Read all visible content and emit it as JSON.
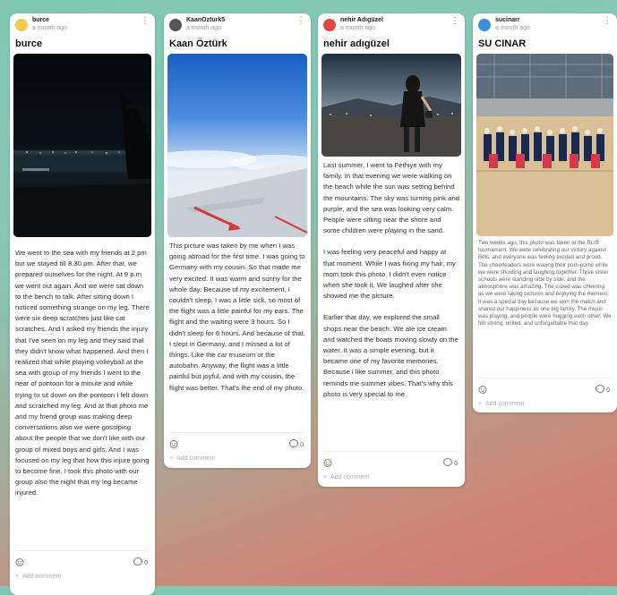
{
  "posts": [
    {
      "username": "burce",
      "time": "a month ago",
      "title": "burce",
      "avatar_color": "#f7c948",
      "paragraphs": [
        "We went to the sea with my friends at 2 pm but we stayed till 8.30 pm. After that, we prepared ourselves for the night. At 9 p.m we went out again. And we were sat down to the bench to talk. After sitting down I noticed something strange on my leg. There were six deep scratches just like cat scratches. And I asked my friends the injury that I've seen on my leg and they said that they didn't know what happened. And then I realized that while playing volleyball at the sea with group of my friends I went to the near of pontoon for a minute and while trying to sit down on the pontoon I felt down and scratched my leg. And at that photo me and my friend group was making deep conversations also we were gossiping about the people that we don't like with our group of mixed boys and girls. And I was focused on my leg that how this injure going to become fine. I took this photo with our group also the night that my leg became injured."
      ],
      "comment_count": "0",
      "add_comment": "Add comment"
    },
    {
      "username": "KaanOzturk5",
      "time": "a month ago",
      "title": "Kaan Öztürk",
      "avatar_color": "#555555",
      "paragraphs": [
        "This picture was taken by me when I was going abroad for the first time. I was going to Germany with my cousin. So that made me very excited. It was warm and sunny for the whole day. Because of my excitement, I couldn't sleep. I was a little sick, so most of the flight was a little painful for my ears. The flight and the waiting were 3 hours. So I didn't sleep for 6 hours. And because of that, I slept in Germany, and I missed a lot of things. Like the car museum or the autobahn. Anyway, the flight was a little painful but joyful, and with my cousin, the flight was better. That's the end of my photo."
      ],
      "comment_count": "0",
      "add_comment": "Add comment"
    },
    {
      "username": "nehir Adıgüzel",
      "time": "a month ago",
      "title": "nehir adıgüzel",
      "avatar_color": "#e0463f",
      "paragraphs": [
        "Last summer, I went to Fethiye with my family. In that evening we were walking on the beach while the sun was setting behind the mountains. The sky was turning pink and purple, and the sea was looking very calm. People were sitting near the shore and some children were playing in the sand.",
        "I was feeling very peaceful and happy at that moment. While I was fixing my hair, my mom took this photo. I didn't even notice when she took it. We laughed after she showed me the picture.",
        "Earlier that day, we explored the small shops near the beach. We ate ice cream and watched the boats moving slowly on the water. It was a simple evening, but it became one of my favorite memories. Because i like summer, and this photo reminds me summer vibes. That's why this photo is very special to me."
      ],
      "comment_count": "0",
      "add_comment": "Add comment"
    },
    {
      "username": "sucinarr",
      "time": "a month ago",
      "title": "SU CINAR",
      "avatar_color": "#3b8fd6",
      "paragraphs": [
        "Two weeks ago, this photo was taken at the BLIS tournament. We were celebrating our victory against Bels, and everyone was feeling excited and proud. The cheerleaders were waving their pom-poms while we were shouting and laughing together. Three sister schools were standing side by side, and the atmosphere was amazing. The crowd was cheering as we were taking pictures and enjoying the moment. It was a special day because we won the match and shared our happiness as one big family. The music was playing, and people were hugging each other. We felt strong, united, and unforgettable that day."
      ],
      "comment_count": "0",
      "add_comment": "Add comment"
    }
  ],
  "icons": {
    "menu": "kebab-icon",
    "react": "reaction-icon",
    "comment": "comment-icon",
    "add": "plus-icon"
  }
}
